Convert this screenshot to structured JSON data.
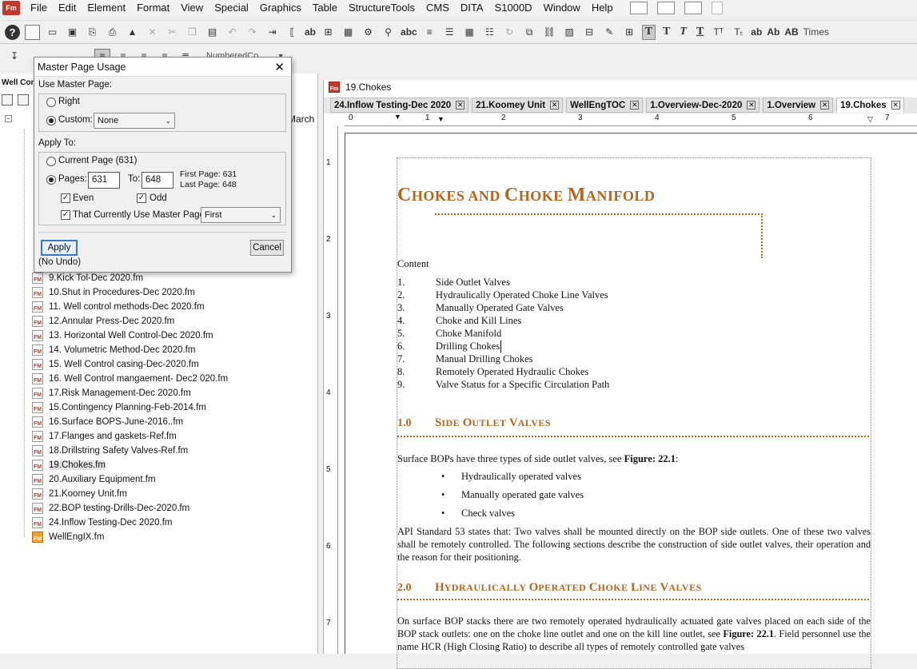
{
  "menubar": {
    "logo": "Fm",
    "items": [
      "File",
      "Edit",
      "Element",
      "Format",
      "View",
      "Special",
      "Graphics",
      "Table",
      "StructureTools",
      "CMS",
      "DITA",
      "S1000D",
      "Window",
      "Help"
    ]
  },
  "toolbar": {
    "font_label": "Times",
    "text_buttons": [
      "T",
      "T",
      "T",
      "T",
      "ab",
      "Ab",
      "AB"
    ],
    "paragraph_tag": "NumberedCo..."
  },
  "book_panel": {
    "title": "Well Con",
    "partial_label": "March",
    "files": [
      {
        "name": "9.Kick Tol-Dec 2020.fm"
      },
      {
        "name": "10.Shut in Procedures-Dec 2020.fm"
      },
      {
        "name": "11. Well control methods-Dec 2020.fm"
      },
      {
        "name": "12.Annular  Press-Dec 2020.fm"
      },
      {
        "name": "13. Horizontal Well Control-Dec 2020.fm"
      },
      {
        "name": "14. Volumetric  Method-Dec 2020.fm"
      },
      {
        "name": "15. Well Control casing-Dec-2020.fm"
      },
      {
        "name": "16. Well Control  mangaement- Dec2 020.fm"
      },
      {
        "name": "17.Risk Management-Dec 2020.fm"
      },
      {
        "name": "15.Contingency Planning-Feb-2014.fm"
      },
      {
        "name": "16.Surface BOPS-June-2016..fm"
      },
      {
        "name": "17.Flanges and  gaskets-Ref.fm"
      },
      {
        "name": "18.Drillstring Safety Valves-Ref.fm"
      },
      {
        "name": "19.Chokes.fm"
      },
      {
        "name": "20.Auxiliary Equipment.fm"
      },
      {
        "name": "21.Koomey  Unit.fm"
      },
      {
        "name": "22.BOP testing-Drills-Dec-2020.fm"
      },
      {
        "name": "24.Inflow Testing-Dec 2020.fm"
      },
      {
        "name": "WellEngIX.fm"
      }
    ],
    "selected_file": "19.Chokes.fm"
  },
  "dialog": {
    "title": "Master Page Usage",
    "close": "✕",
    "use_master_label": "Use Master Page:",
    "right_label": "Right",
    "custom_label": "Custom:",
    "custom_value": "None",
    "apply_to_label": "Apply To:",
    "current_page_label": "Current Page  (631)",
    "pages_label": "Pages:",
    "pages_from": "631",
    "to_label": "To:",
    "pages_to": "648",
    "first_page": "First Page:  631",
    "last_page": "Last Page:  648",
    "even_label": "Even",
    "odd_label": "Odd",
    "currently_use_label": "That Currently Use Master Page:",
    "currently_use_value": "First",
    "apply_button": "Apply",
    "cancel_button": "Cancel",
    "no_undo": "(No Undo)"
  },
  "document": {
    "window_title": "19.Chokes",
    "tabs": [
      {
        "label": "24.Inflow Testing-Dec 2020",
        "active": false
      },
      {
        "label": "21.Koomey  Unit",
        "active": false
      },
      {
        "label": "WellEngTOC",
        "active": false
      },
      {
        "label": "1.Overview-Dec-2020",
        "active": false
      },
      {
        "label": "1.Overview",
        "active": false
      },
      {
        "label": "19.Chokes",
        "active": true
      }
    ],
    "ruler_numbers": [
      "0",
      "1",
      "2",
      "3",
      "4",
      "5",
      "6",
      "7"
    ],
    "vruler_numbers": [
      "1",
      "2",
      "3",
      "4",
      "5",
      "6",
      "7"
    ],
    "title_parts": [
      "C",
      "HOKES AND ",
      "C",
      "HOKE ",
      "M",
      "ANIFOLD"
    ],
    "content_label": "Content",
    "toc": [
      {
        "num": "1.",
        "text": "Side Outlet Valves"
      },
      {
        "num": "2.",
        "text": "Hydraulically Operated Choke Line Valves"
      },
      {
        "num": "3.",
        "text": "Manually Operated Gate Valves"
      },
      {
        "num": "4.",
        "text": "Choke and Kill Lines"
      },
      {
        "num": "5.",
        "text": "Choke Manifold"
      },
      {
        "num": "6.",
        "text": "Drilling Chokes"
      },
      {
        "num": "7.",
        "text": "Manual Drilling Chokes"
      },
      {
        "num": "8.",
        "text": "Remotely Operated Hydraulic Chokes"
      },
      {
        "num": "9.",
        "text": "Valve Status for a Specific Circulation Path"
      }
    ],
    "section1": {
      "num": "1.0",
      "cap1": "S",
      "rest1": "IDE ",
      "cap2": "O",
      "rest2": "UTLET ",
      "cap3": "V",
      "rest3": "ALVES"
    },
    "section1_intro_pre": "Surface BOPs have three types of side outlet valves, see ",
    "section1_intro_bold": "Figure: 22.1",
    "section1_intro_post": ":",
    "bullets": [
      "Hydraulically operated valves",
      "Manually operated gate valves",
      "Check valves"
    ],
    "bullet_glyph": "•",
    "api_paragraph": "API Standard 53 states that: Two valves shall be mounted directly on the BOP side outlets. One of these two valves shall be remotely controlled. The following sections describe the construction of side outlet valves, their operation and the reason for their positioning.",
    "section2": {
      "num": "2.0",
      "cap1": "H",
      "rest1": "YDRAULICALLY ",
      "cap2": "O",
      "rest2": "PERATED ",
      "cap3": "C",
      "rest3": "HOKE ",
      "cap4": "L",
      "rest4": "INE ",
      "cap5": "V",
      "rest5": "ALVES"
    },
    "section2_p1": "On surface BOP stacks there are two remotely operated hydraulically actuated gate valves placed on each side of the BOP stack outlets: one on the choke line outlet and one on the kill line outlet, see ",
    "section2_p1_bold": "Figure: 22.1",
    "section2_p1_post": ". Field personnel use the name HCR (High Closing Ratio) to describe all types of remotely controlled gate valves"
  },
  "colors": {
    "accent": "#b5651d",
    "dialog_default_border": "#3b78c4"
  }
}
